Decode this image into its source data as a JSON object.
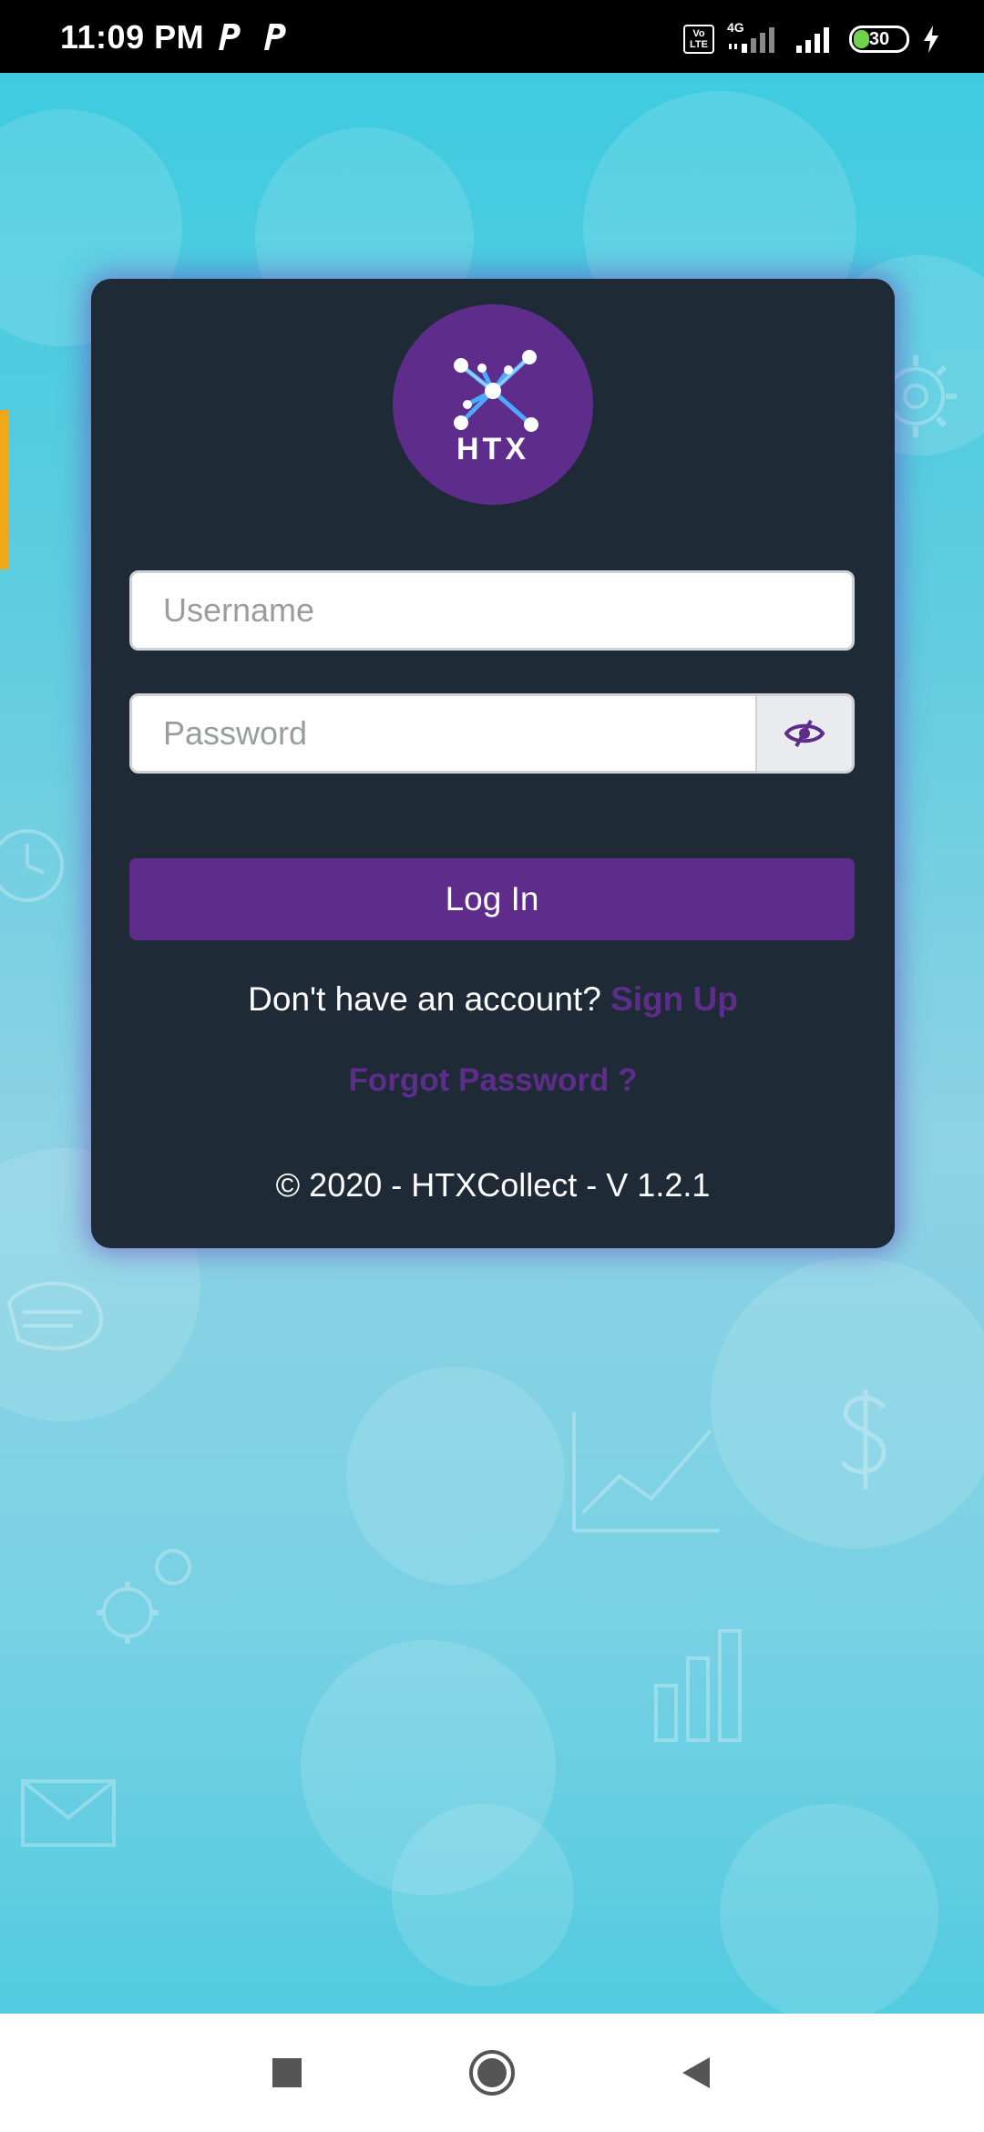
{
  "status_bar": {
    "time": "11:09 PM",
    "notification_icons": [
      "parking-app-icon",
      "parking-app-icon"
    ],
    "volte_label": "Vo LTE",
    "network_label": "4G",
    "battery_level": "30",
    "charging": true
  },
  "login": {
    "logo_text": "HTX",
    "username_placeholder": "Username",
    "password_placeholder": "Password",
    "login_label": "Log In",
    "signup_prompt": "Don't have an account?",
    "signup_link": "Sign Up",
    "forgot_link": "Forgot Password ?",
    "copyright": "© 2020 - HTXCollect - V 1.2.1"
  },
  "colors": {
    "accent": "#5e2d8c",
    "card_background": "#1f2a37",
    "page_background": "#4cc8dc"
  },
  "nav_bar": {
    "buttons": [
      "recents-square-icon",
      "home-circle-icon",
      "back-triangle-icon"
    ]
  }
}
